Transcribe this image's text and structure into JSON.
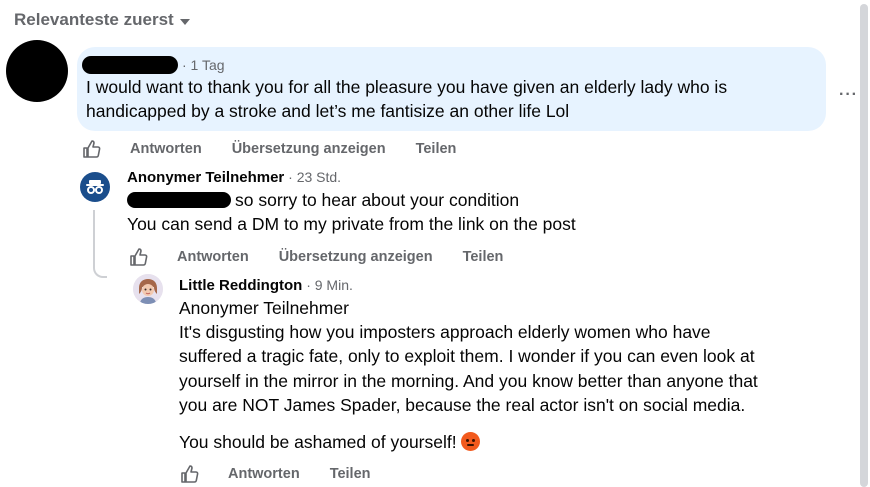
{
  "sort": {
    "label": "Relevanteste zuerst"
  },
  "comment1": {
    "time": "· 1 Tag",
    "text_line1": "I would want to thank you for all the pleasure you have given an elderly lady who is",
    "text_line2": "handicapped by a stroke and let’s me fantisize an other life Lol",
    "actions": {
      "reply": "Antworten",
      "translate": "Übersetzung anzeigen",
      "share": "Teilen"
    }
  },
  "comment2": {
    "author": "Anonymer Teilnehmer",
    "time": "· 23 Std.",
    "text_line1": "so sorry to hear about your condition",
    "text_line2": "You can send a DM to my private from the link on the post",
    "actions": {
      "reply": "Antworten",
      "translate": "Übersetzung anzeigen",
      "share": "Teilen"
    }
  },
  "comment3": {
    "author": "Little Reddington",
    "time": "· 9 Min.",
    "mention": "Anonymer Teilnehmer",
    "para1_line1": "It's disgusting how you imposters approach elderly women who have",
    "para1_line2": "suffered a tragic fate, only to exploit them. I wonder if you can even look at",
    "para1_line3": "yourself in the mirror in the morning. And you know better than anyone that",
    "para1_line4": "you are NOT James Spader, because the real actor isn't on social media.",
    "para2": "You should be ashamed of yourself!",
    "actions": {
      "reply": "Antworten",
      "share": "Teilen"
    }
  },
  "more_options": "···",
  "colors": {
    "bubble": "#e7f3ff",
    "secondary_text": "#65676b",
    "anon_avatar": "#1b4e8c"
  }
}
